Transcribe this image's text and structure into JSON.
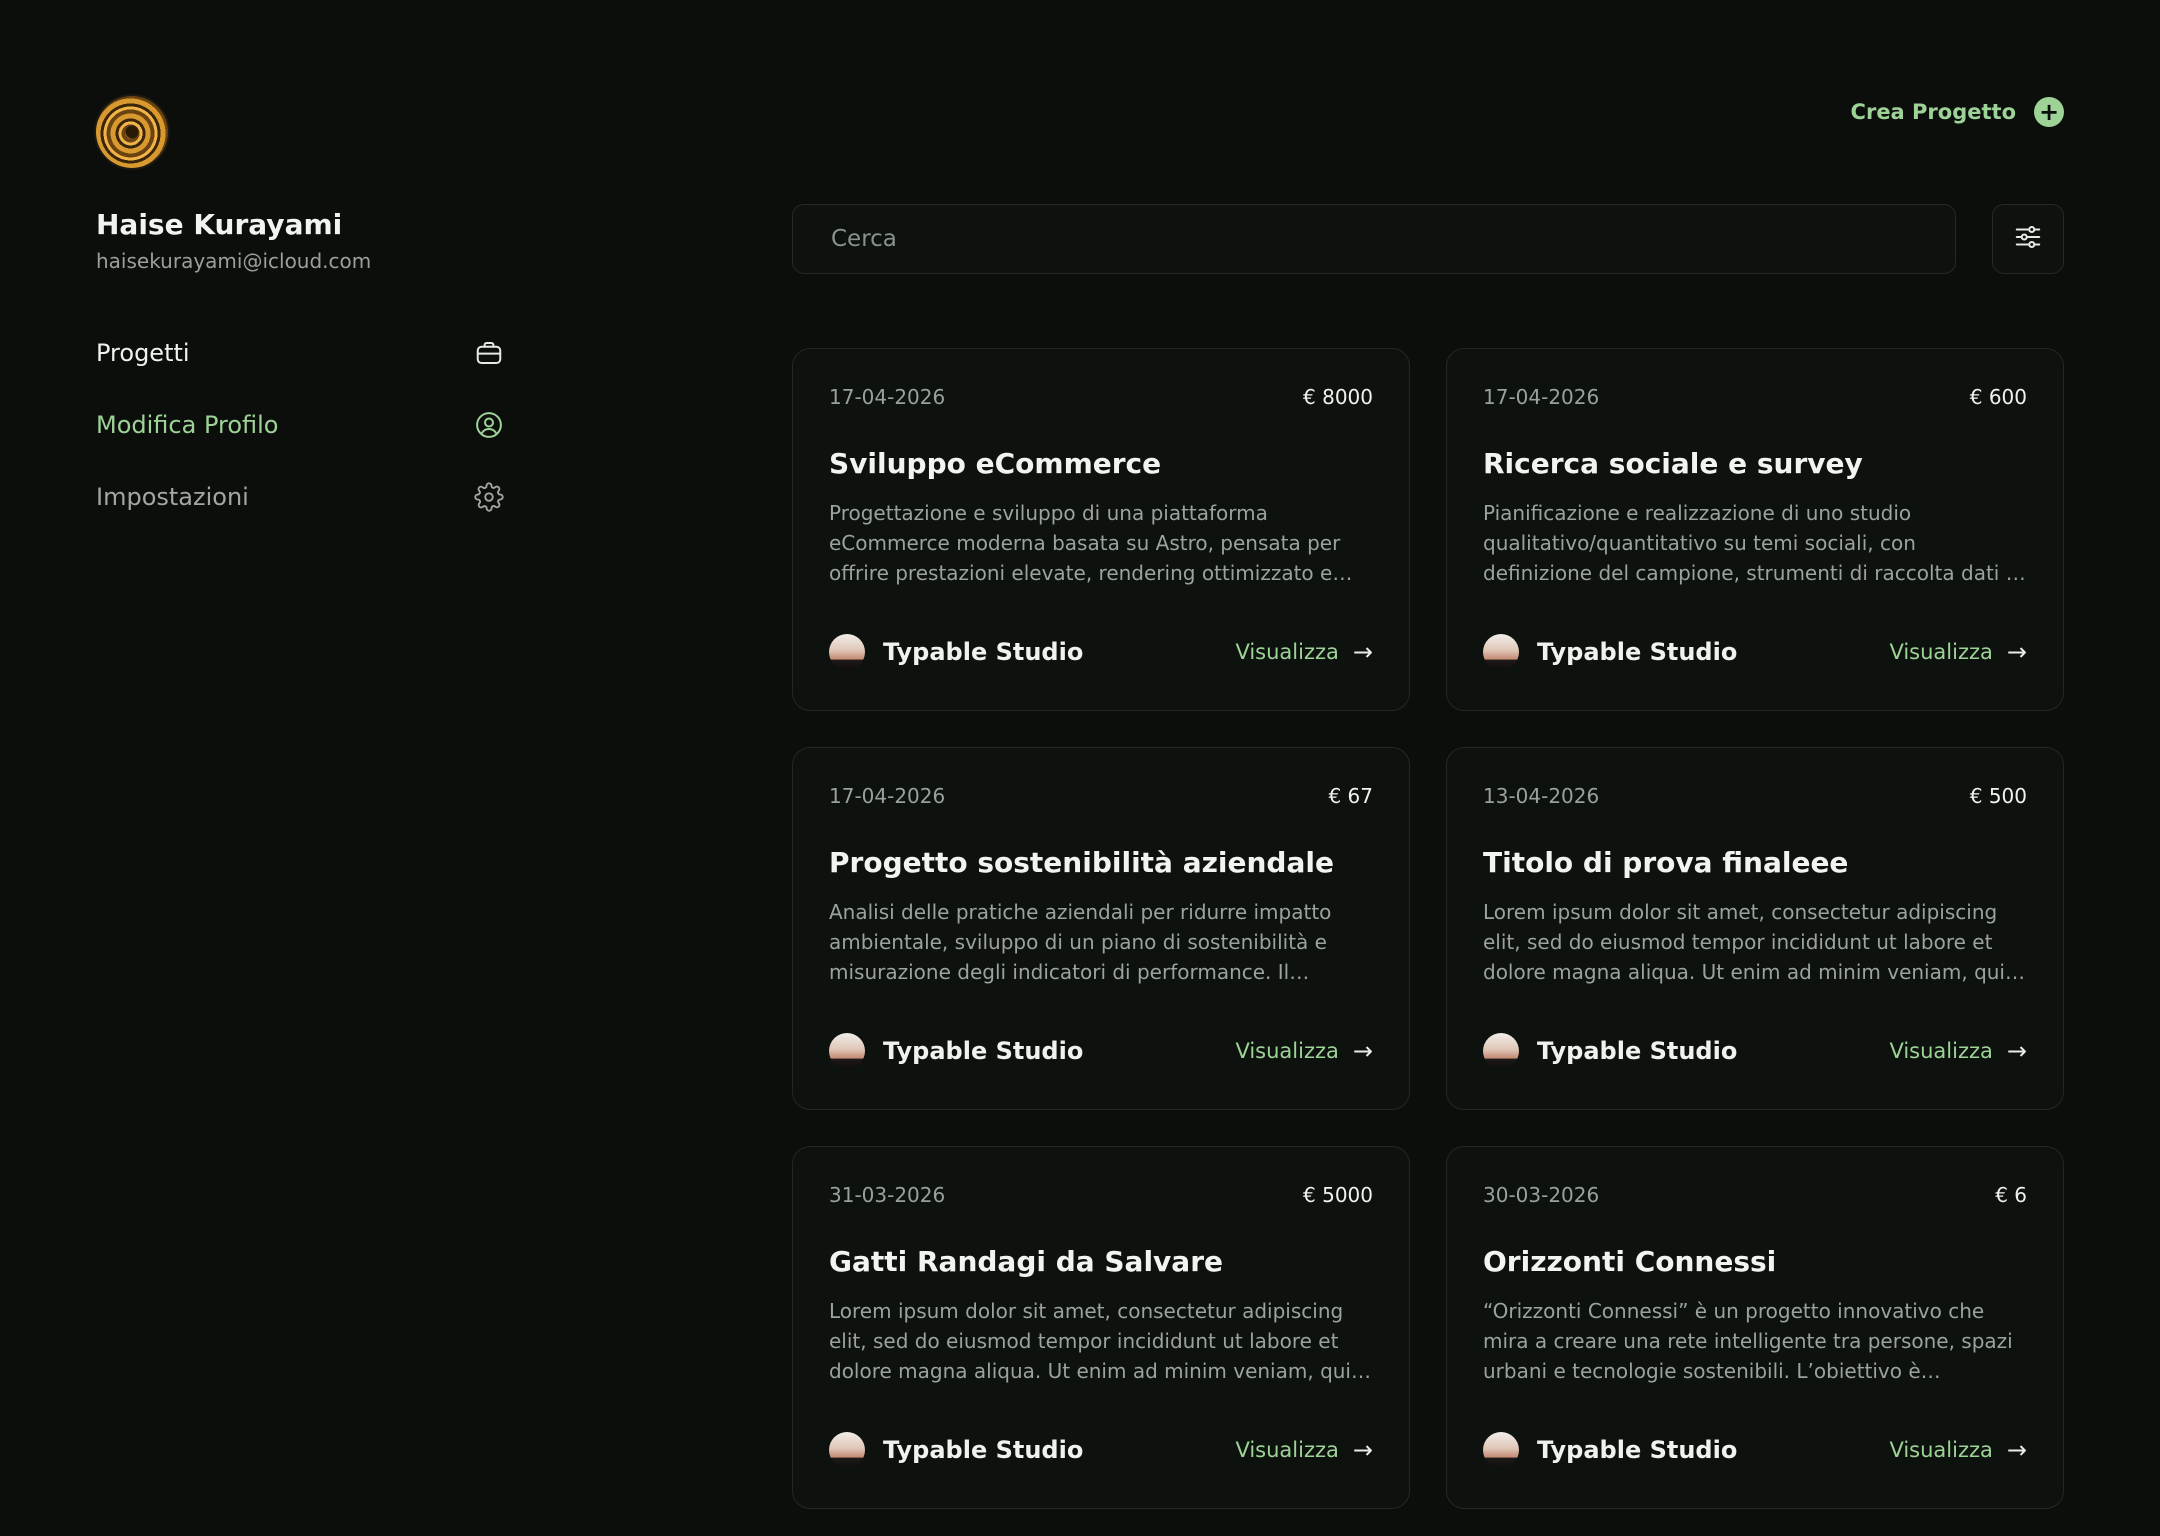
{
  "user": {
    "name": "Haise Kurayami",
    "email": "haisekurayami@icloud.com"
  },
  "nav": {
    "items": [
      {
        "label": "Progetti",
        "icon": "briefcase-icon"
      },
      {
        "label": "Modifica Profilo",
        "icon": "user-circle-icon",
        "active": true
      },
      {
        "label": "Impostazioni",
        "icon": "gear-icon"
      }
    ]
  },
  "header": {
    "create_label": "Crea Progetto",
    "create_icon": "+"
  },
  "search": {
    "placeholder": "Cerca"
  },
  "colors": {
    "background": "#0b0e0b",
    "card": "#0e120e",
    "accent": "#9ed398",
    "muted_text": "#9ca29c"
  },
  "projects": [
    {
      "date": "17-04-2026",
      "price": "€ 8000",
      "title": "Sviluppo eCommerce",
      "description": "Progettazione e sviluppo di una piattaforma eCommerce moderna basata su Astro, pensata per offrire prestazioni elevate, rendering ottimizzato e un...",
      "studio": "Typable Studio",
      "action": "Visualizza",
      "arrow": "→"
    },
    {
      "date": "17-04-2026",
      "price": "€ 600",
      "title": "Ricerca sociale e survey",
      "description": "Pianificazione e realizzazione di uno studio qualitativo/quantitativo su temi sociali, con definizione del campione, strumenti di raccolta dati e analisi dei...",
      "studio": "Typable Studio",
      "action": "Visualizza",
      "arrow": "→"
    },
    {
      "date": "17-04-2026",
      "price": "€ 67",
      "title": "Progetto sostenibilità aziendale",
      "description": "Analisi delle pratiche aziendali per ridurre impatto ambientale, sviluppo di un piano di sostenibilità e misurazione degli indicatori di performance. Il progett...",
      "studio": "Typable Studio",
      "action": "Visualizza",
      "arrow": "→"
    },
    {
      "date": "13-04-2026",
      "price": "€ 500",
      "title": "Titolo di prova finaleee",
      "description": "Lorem ipsum dolor sit amet, consectetur adipiscing elit, sed do eiusmod tempor incididunt ut labore et dolore magna aliqua. Ut enim ad minim veniam, quis nostrud...",
      "studio": "Typable Studio",
      "action": "Visualizza",
      "arrow": "→"
    },
    {
      "date": "31-03-2026",
      "price": "€ 5000",
      "title": "Gatti Randagi da Salvare",
      "description": "Lorem ipsum dolor sit amet, consectetur adipiscing elit, sed do eiusmod tempor incididunt ut labore et dolore magna aliqua. Ut enim ad minim veniam, quis nostrud...",
      "studio": "Typable Studio",
      "action": "Visualizza",
      "arrow": "→"
    },
    {
      "date": "30-03-2026",
      "price": "€ 6",
      "title": "Orizzonti Connessi",
      "description": "“Orizzonti Connessi” è un progetto innovativo che mira a creare una rete intelligente tra persone, spazi urbani e tecnologie sostenibili. L’obiettivo è trasformare le...",
      "studio": "Typable Studio",
      "action": "Visualizza",
      "arrow": "→"
    }
  ]
}
